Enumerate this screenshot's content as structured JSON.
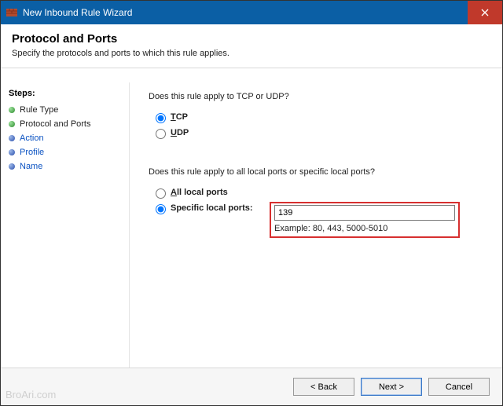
{
  "window": {
    "title": "New Inbound Rule Wizard"
  },
  "header": {
    "title": "Protocol and Ports",
    "subtitle": "Specify the protocols and ports to which this rule applies."
  },
  "steps": {
    "heading": "Steps:",
    "items": [
      {
        "label": "Rule Type",
        "state": "done"
      },
      {
        "label": "Protocol and Ports",
        "state": "current"
      },
      {
        "label": "Action",
        "state": "pending"
      },
      {
        "label": "Profile",
        "state": "pending"
      },
      {
        "label": "Name",
        "state": "pending"
      }
    ]
  },
  "main": {
    "protocol_question": "Does this rule apply to TCP or UDP?",
    "protocol_options": {
      "tcp": "TCP",
      "udp": "UDP",
      "selected": "tcp"
    },
    "ports_question": "Does this rule apply to all local ports or specific local ports?",
    "ports_options": {
      "all": "All local ports",
      "specific": "Specific local ports:",
      "selected": "specific"
    },
    "port_value": "139",
    "port_example": "Example: 80, 443, 5000-5010"
  },
  "buttons": {
    "back": "< Back",
    "next": "Next >",
    "cancel": "Cancel"
  },
  "watermark": "BroAri.com"
}
